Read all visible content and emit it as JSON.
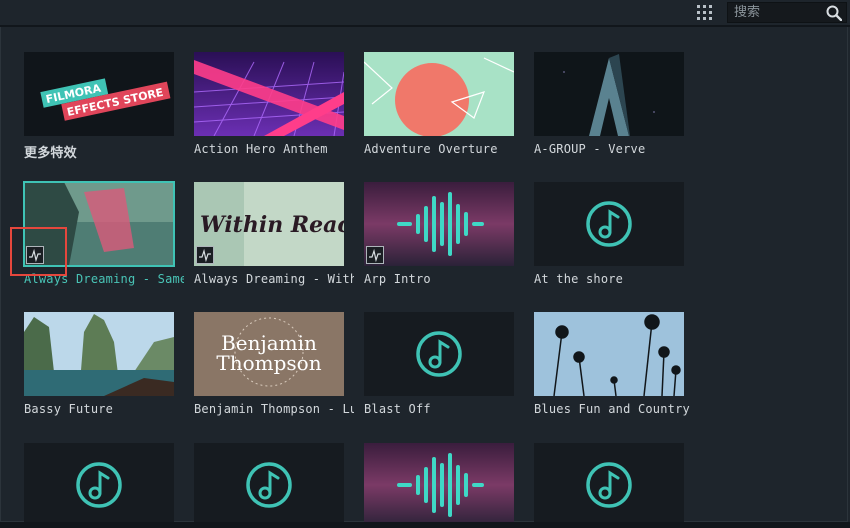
{
  "toolbar": {
    "grid_icon": "grid-dots-icon",
    "search_placeholder": "搜索",
    "search_icon": "search-icon"
  },
  "store": {
    "logo_line1": "FILMORA",
    "logo_line2": "EFFECTS STORE"
  },
  "thumb_text": {
    "within_reach": "Within Reach",
    "benjamin_line1": "Benjamin",
    "benjamin_line2": "Thompson"
  },
  "items": [
    {
      "label": "更多特效",
      "thumb": "store"
    },
    {
      "label": "Action Hero Anthem",
      "thumb": "retro-grid"
    },
    {
      "label": "Adventure Overture",
      "thumb": "sun-shapes"
    },
    {
      "label": "A-GROUP - Verve",
      "thumb": "dark-letter-a"
    },
    {
      "label": "Always Dreaming - Same",
      "thumb": "coast-photo",
      "selected": true
    },
    {
      "label": "Always Dreaming - With",
      "thumb": "within-reach-title"
    },
    {
      "label": "Arp Intro",
      "thumb": "waveform"
    },
    {
      "label": "At the shore",
      "thumb": "music-note"
    },
    {
      "label": "Bassy Future",
      "thumb": "cliff-boat-photo"
    },
    {
      "label": "Benjamin Thompson - Lu",
      "thumb": "benjamin-title"
    },
    {
      "label": "Blast Off",
      "thumb": "music-note"
    },
    {
      "label": "Blues Fun and Country",
      "thumb": "palm-trees"
    },
    {
      "label": "",
      "thumb": "music-note"
    },
    {
      "label": "",
      "thumb": "music-note"
    },
    {
      "label": "",
      "thumb": "waveform"
    },
    {
      "label": "",
      "thumb": "music-note"
    }
  ],
  "colors": {
    "background": "#1e252c",
    "accent_teal": "#3fc3b5",
    "highlight_red": "#e5473d"
  }
}
